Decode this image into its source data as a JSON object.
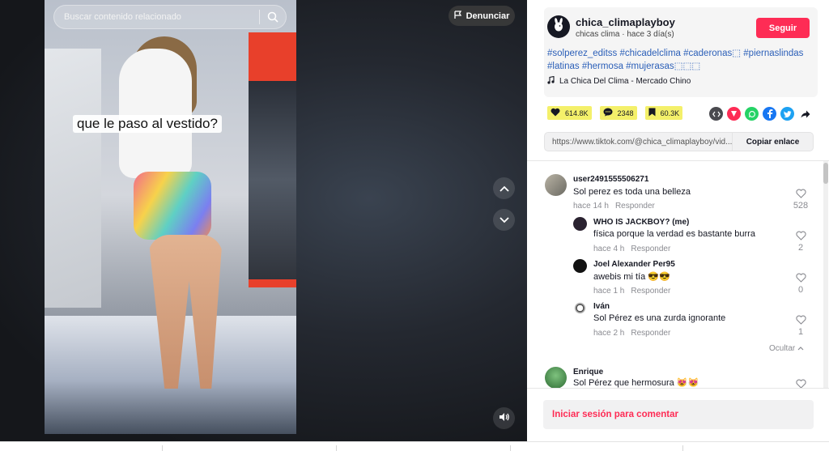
{
  "video": {
    "search_placeholder": "Buscar contenido relacionado",
    "report_label": "Denunciar",
    "caption_overlay": "que le paso al vestido?"
  },
  "author": {
    "username": "chica_climaplayboy",
    "subline": "chicas clima · hace 3 día(s)",
    "follow_label": "Seguir"
  },
  "description": "#solperez_editss #chicadelclima #caderonas⬚ #piernaslindas #latinas #hermosa #mujerasas⬚⬚⬚",
  "music": "La Chica Del Clima - Mercado Chino",
  "stats": {
    "likes": "614.8K",
    "comments": "2348",
    "saves": "60.3K"
  },
  "share_icons": [
    "embed-icon",
    "share-red-icon",
    "whatsapp-icon",
    "facebook-icon",
    "twitter-icon",
    "forward-icon"
  ],
  "link": {
    "url": "https://www.tiktok.com/@chica_climaplayboy/vid...",
    "copy_label": "Copiar enlace"
  },
  "comments": [
    {
      "name": "user2491555506271",
      "text": "Sol perez es toda una belleza",
      "time": "hace 14 h",
      "reply": "Responder",
      "likes": "528"
    },
    {
      "name": "WHO IS JACKBOY? (me)",
      "text": "física porque la verdad es bastante burra",
      "time": "hace 4 h",
      "reply": "Responder",
      "likes": "2"
    },
    {
      "name": "Joel Alexander Per95",
      "text": "awebis mi tía 😎😎",
      "time": "hace 1 h",
      "reply": "Responder",
      "likes": "0"
    },
    {
      "name": "Iván",
      "text": "Sol Pérez es una zurda ignorante",
      "time": "hace 2 h",
      "reply": "Responder",
      "likes": "1"
    },
    {
      "name": "Enrique",
      "text": "Sol Pérez que hermosura 😻😻",
      "time": "",
      "reply": "",
      "likes": ""
    }
  ],
  "hide_label": "Ocultar",
  "login_prompt": "Iniciar sesión para comentar",
  "colors": {
    "accent": "#fe2c55",
    "hashtag": "#2b5fb8",
    "highlight": "#f4f06a"
  }
}
